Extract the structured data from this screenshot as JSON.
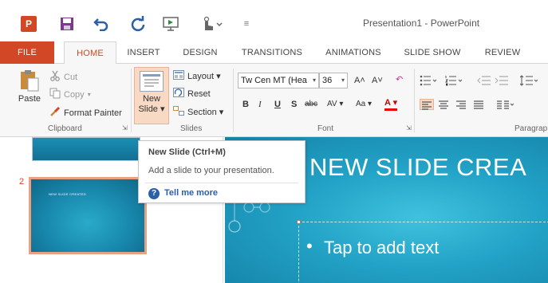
{
  "colors": {
    "accent": "#d24726",
    "slide_blue": "#22a2c6",
    "link_blue": "#2b5fa6"
  },
  "quick_access": {
    "app_icon_label": "P",
    "customize_glyph": "≡",
    "icons": [
      "powerpoint-logo-icon",
      "save-icon",
      "undo-icon",
      "redo-icon",
      "start-from-beginning-icon",
      "touch-mode-icon",
      "customize-toolbar-icon"
    ]
  },
  "window": {
    "title": "Presentation1 - PowerPoint"
  },
  "tabs": [
    {
      "label": "FILE"
    },
    {
      "label": "HOME"
    },
    {
      "label": "INSERT"
    },
    {
      "label": "DESIGN"
    },
    {
      "label": "TRANSITIONS"
    },
    {
      "label": "ANIMATIONS"
    },
    {
      "label": "SLIDE SHOW"
    },
    {
      "label": "REVIEW"
    }
  ],
  "ribbon": {
    "clipboard": {
      "paste": "Paste",
      "cut": "Cut",
      "copy": "Copy",
      "copy_arrow": "▾",
      "format_painter": "Format Painter",
      "group_label": "Clipboard"
    },
    "slides": {
      "new_slide_line1": "New",
      "new_slide_line2": "Slide ▾",
      "layout": "Layout ▾",
      "reset": "Reset",
      "section": "Section ▾",
      "group_label": "Slides"
    },
    "font": {
      "font_name": "Tw Cen MT (Hea",
      "font_size": "36",
      "grow": "A˄",
      "shrink": "A˅",
      "clear": "↶",
      "bold": "B",
      "italic": "I",
      "underline": "U",
      "shadow": "S",
      "strike": "abc",
      "spacing": "AV ▾",
      "case": "Aa ▾",
      "color": "A ▾",
      "group_label": "Font"
    },
    "paragraph": {
      "group_label": "Paragrap"
    }
  },
  "thumbnails": {
    "slide2_number": "2",
    "slide2_title": "NEW SLIDE CREATED"
  },
  "slide": {
    "title": "NEW SLIDE CREA",
    "bullet": "•",
    "placeholder": "Tap to add text"
  },
  "tooltip": {
    "title": "New Slide (Ctrl+M)",
    "description": "Add a slide to your presentation.",
    "help_glyph": "?",
    "more": "Tell me more"
  }
}
